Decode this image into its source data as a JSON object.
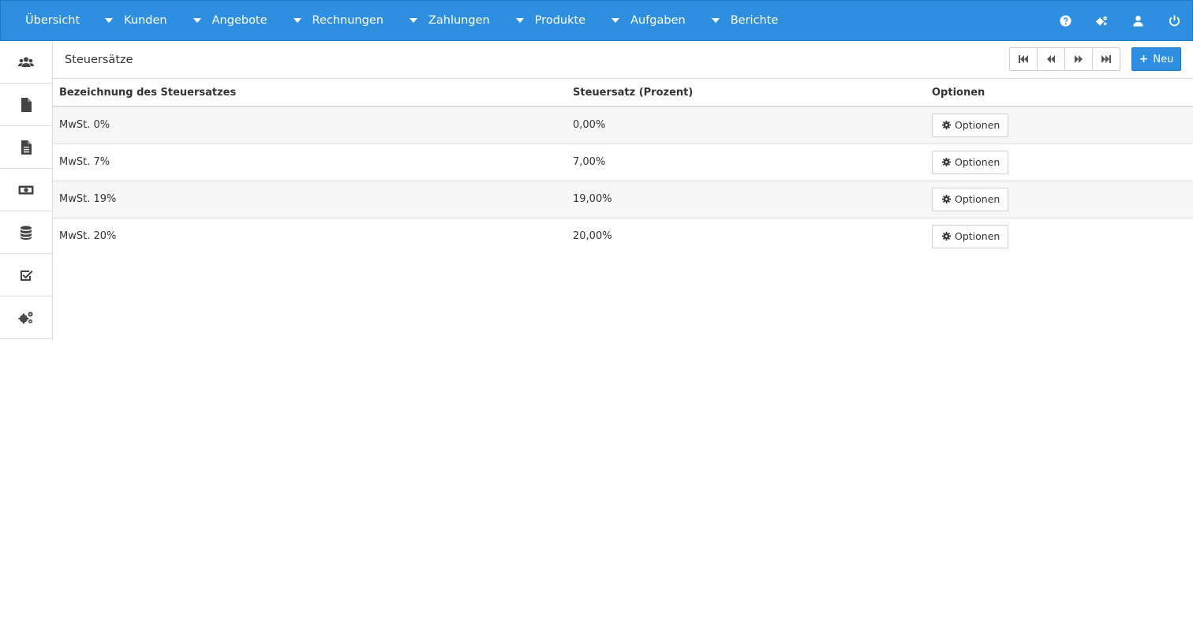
{
  "nav": {
    "items": [
      {
        "label": "Übersicht",
        "dropdown": false
      },
      {
        "label": "Kunden",
        "dropdown": true
      },
      {
        "label": "Angebote",
        "dropdown": true
      },
      {
        "label": "Rechnungen",
        "dropdown": true
      },
      {
        "label": "Zahlungen",
        "dropdown": true
      },
      {
        "label": "Produkte",
        "dropdown": true
      },
      {
        "label": "Aufgaben",
        "dropdown": true
      },
      {
        "label": "Berichte",
        "dropdown": true
      }
    ],
    "right_icons": [
      "help-icon",
      "settings-icon",
      "user-icon",
      "power-icon"
    ]
  },
  "sidebar": {
    "items": [
      "users-icon",
      "quote-file-icon",
      "invoice-file-icon",
      "money-icon",
      "database-icon",
      "tasks-check-icon",
      "settings-icon"
    ]
  },
  "header": {
    "title": "Steuersätze",
    "new_label": "Neu"
  },
  "table": {
    "columns": [
      "Bezeichnung des Steuersatzes",
      "Steuersatz (Prozent)",
      "Optionen"
    ],
    "rows": [
      {
        "name": "MwSt. 0%",
        "rate": "0,00%",
        "options": "Optionen"
      },
      {
        "name": "MwSt. 7%",
        "rate": "7,00%",
        "options": "Optionen"
      },
      {
        "name": "MwSt. 19%",
        "rate": "19,00%",
        "options": "Optionen"
      },
      {
        "name": "MwSt. 20%",
        "rate": "20,00%",
        "options": "Optionen"
      }
    ]
  },
  "colors": {
    "primary": "#2e8fe0",
    "border": "#dcdcdc",
    "row_alt": "#f7f7f7"
  }
}
